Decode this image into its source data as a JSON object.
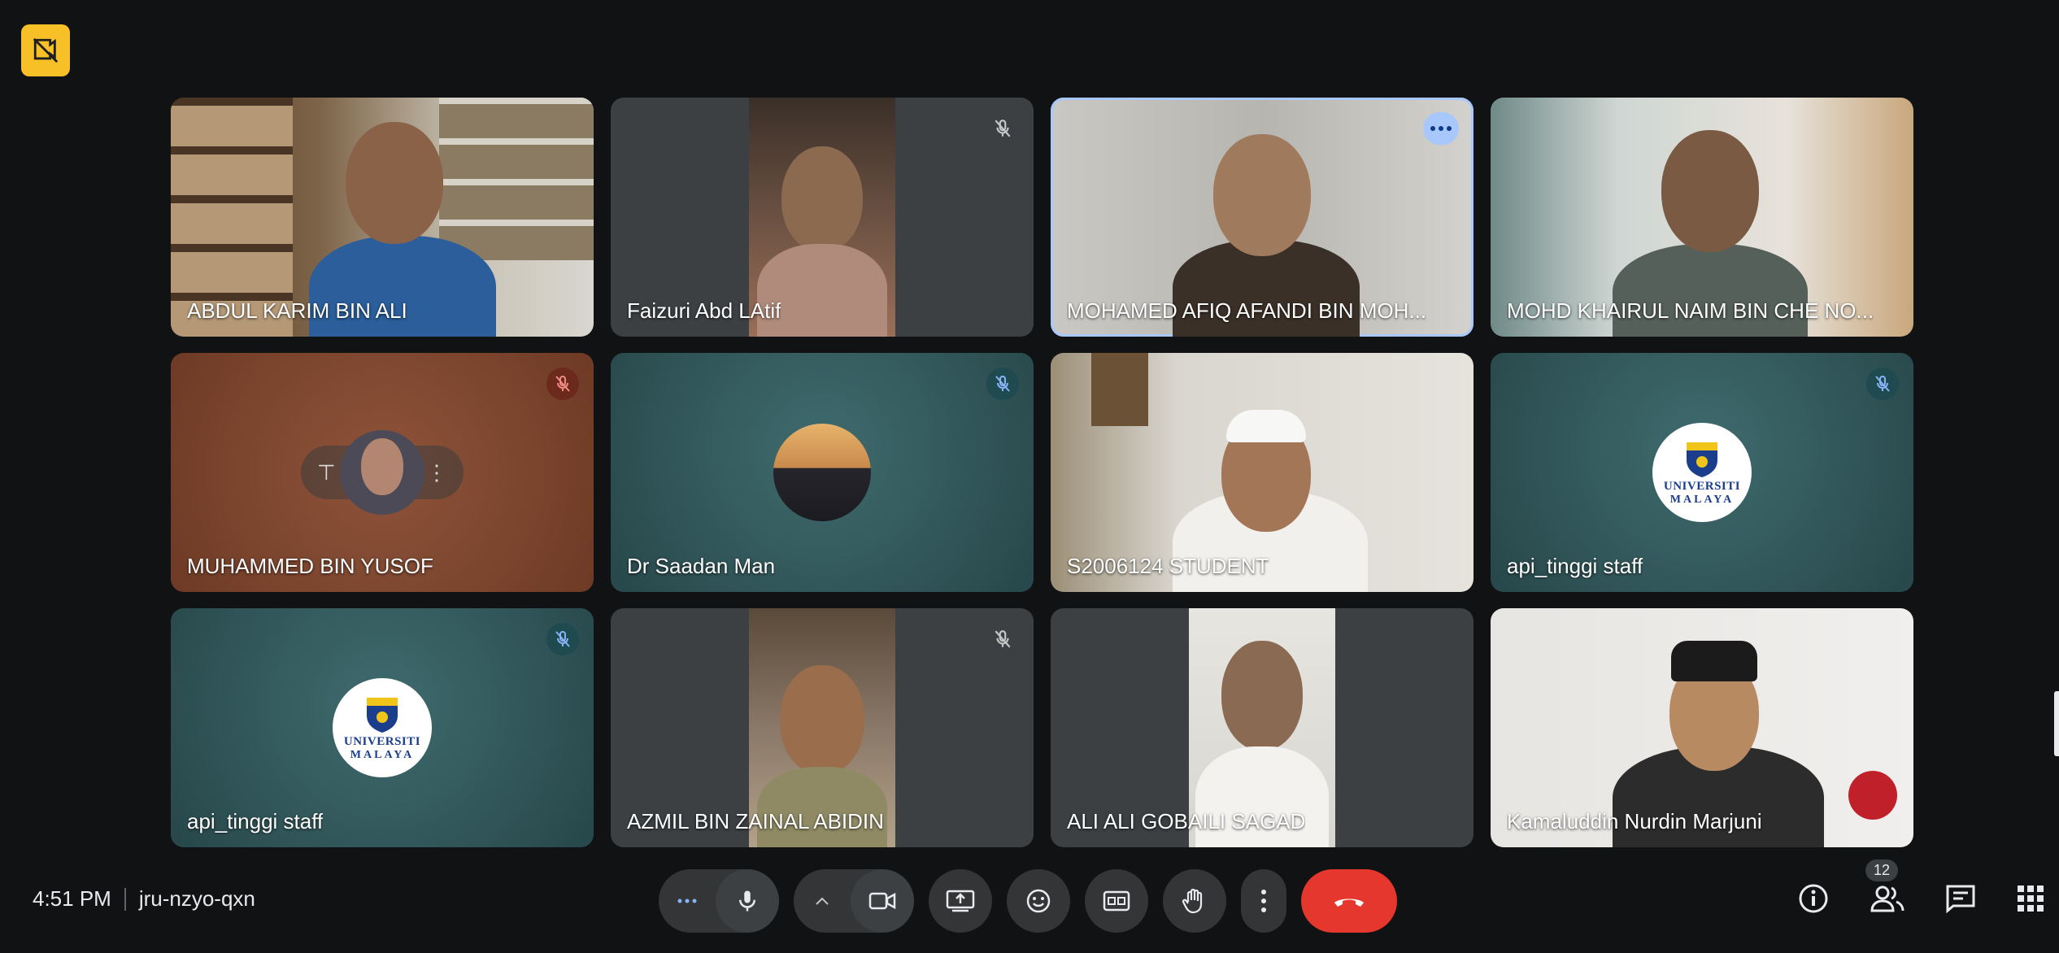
{
  "meeting": {
    "time": "4:51 PM",
    "code": "jru-nzyo-qxn",
    "participant_count": "12"
  },
  "tiles": [
    {
      "name": "ABDUL KARIM BIN ALI"
    },
    {
      "name": "Faizuri Abd LAtif"
    },
    {
      "name": "MOHAMED AFIQ AFANDI BIN MOH..."
    },
    {
      "name": "MOHD KHAIRUL NAIM BIN CHE NO..."
    },
    {
      "name": "MUHAMMED BIN YUSOF"
    },
    {
      "name": "Dr Saadan Man"
    },
    {
      "name": "S2006124 STUDENT"
    },
    {
      "name": "api_tinggi staff"
    },
    {
      "name": "api_tinggi staff"
    },
    {
      "name": "AZMIL BIN ZAINAL ABIDIN"
    },
    {
      "name": "ALI ALI GOBAILI SAGAD"
    },
    {
      "name": "Kamaluddin Nurdin Marjuni"
    }
  ],
  "logo": {
    "line1": "UNIVERSITI",
    "line2": "MALAYA"
  },
  "colors": {
    "end_call": "#e5372d",
    "active_outline": "#a8c7fa",
    "badge": "#f6c026"
  }
}
